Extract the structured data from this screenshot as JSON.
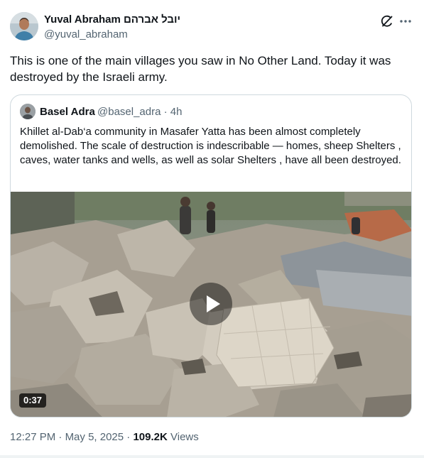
{
  "author": {
    "name": "Yuval Abraham יובל אברהם",
    "handle": "@yuval_abraham"
  },
  "tweet": {
    "text": "This is one of the main villages you saw in No Other Land. Today it was destroyed by the Israeli army."
  },
  "quote": {
    "name": "Basel Adra",
    "handle": "@basel_adra",
    "separator": "·",
    "time": "4h",
    "text": "Khillet al-Dab‘a community in Masafer Yatta has been almost completely demolished. The scale of destruction is indescribable — homes, sheep Shelters , caves, water tanks and wells, as well as solar Shelters , have all been destroyed.",
    "video_duration": "0:37"
  },
  "footer": {
    "time": "12:27 PM",
    "dot1": "·",
    "date": "May 5, 2025",
    "dot2": "·",
    "views_count": "109.2K",
    "views_label": "Views"
  },
  "icons": {
    "grok": "grok-icon",
    "more": "more-icon",
    "play": "play-icon"
  },
  "colors": {
    "text": "#0f1419",
    "secondary": "#536471",
    "border": "#cfd9de"
  }
}
